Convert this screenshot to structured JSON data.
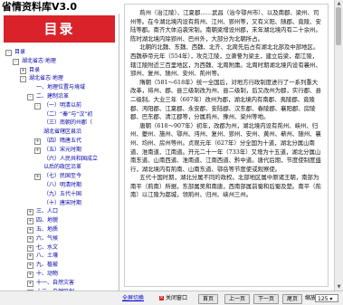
{
  "app": {
    "title": "省情资料库V3.0"
  },
  "sidebar": {
    "header": "目录",
    "tree": [
      {
        "label": "目录",
        "level": 0,
        "toggle": "-"
      },
      {
        "label": "湖北省志·地理",
        "level": 1,
        "toggle": "-"
      },
      {
        "label": "目录",
        "level": 2,
        "toggle": "+"
      },
      {
        "label": "湖北省志·地理",
        "level": 2,
        "toggle": "-"
      },
      {
        "label": "一、地理位置与境域",
        "level": 3,
        "toggle": ""
      },
      {
        "label": "二、建制沿革",
        "level": 3,
        "toggle": "-"
      },
      {
        "label": "（一）明清以前",
        "level": 4,
        "toggle": "-"
      },
      {
        "label": "（二）“秦”与“汉”初",
        "level": 4,
        "toggle": ""
      },
      {
        "label": "（三）南朝的州郡（",
        "level": 4,
        "toggle": ""
      },
      {
        "label": "湖北省辖区县沿",
        "level": 4,
        "toggle": ""
      },
      {
        "label": "（四）隋唐五代",
        "level": 4,
        "toggle": "+"
      },
      {
        "label": "（五）宋元时期",
        "level": 4,
        "toggle": "+"
      },
      {
        "label": "（六）人民共和国成立",
        "level": 4,
        "toggle": ""
      },
      {
        "label": "以后的政区沿革",
        "level": 4,
        "toggle": ""
      },
      {
        "label": "（七）民国至今",
        "level": 4,
        "toggle": "+"
      },
      {
        "label": "（八）明清时期",
        "level": 4,
        "toggle": ""
      },
      {
        "label": "（九）五代十国",
        "level": 4,
        "toggle": ""
      },
      {
        "label": "（十）唐宋时期",
        "level": 4,
        "toggle": ""
      },
      {
        "label": "三、人口",
        "level": 3,
        "toggle": "+"
      },
      {
        "label": "四、地貌",
        "level": 3,
        "toggle": "+"
      },
      {
        "label": "五、地质",
        "level": 3,
        "toggle": "+"
      },
      {
        "label": "六、气候",
        "level": 3,
        "toggle": "+"
      },
      {
        "label": "七、水文",
        "level": 3,
        "toggle": "+"
      },
      {
        "label": "八、土壤",
        "level": 3,
        "toggle": "+"
      },
      {
        "label": "九、植被",
        "level": 3,
        "toggle": "+"
      },
      {
        "label": "十、动物",
        "level": 3,
        "toggle": "+"
      },
      {
        "label": "十一、自然灾害",
        "level": 3,
        "toggle": "+"
      },
      {
        "label": "十二、自然区划",
        "level": 3,
        "toggle": "+"
      }
    ]
  },
  "document": {
    "paragraphs": [
      "荊州（治江陵）、江夏郡……武昌（治今鄂州市）、以及南郡、梁州、司州等。在今湖北境内设有荊州、江州、郢州等，又有义阳、随郡、竟陵、安陆等郡。南齐大体沿袭宋制。南朝梁增设州郡，末年湖北境内有二十余州。陈时湖北境内除郢州、巴州外，大部分为北朝所占。",
      "北朝的北魏、东魏、西魏、北齐、北周先后占有湖北北部及中部地区。西魏恭帝元年（554年），攻克江陵，立萧詧为梁主，建立后梁，都江陵，辖江陵附近三百里地区，为西魏、北周附庸。北周时期湖北境内设有襄州、郢州、复州、随州、安州、荊州等。",
      "隋朝（581～618年）统一全国后，对地方行政制度进行了一系列重大改革，将州、郡、县三级制改为州、县二级制，后又改州为郡，实行郡、县二级制。大业三年（607年）改州为郡，湖北境内有南郡、夷陵郡、竟陵郡、沔阳郡、江夏郡、永安郡、安陆郡、汉东郡、春陵郡、襄阳郡、房陵郡、巴东郡、清江郡等，分属荊州、豫州、梁州等地。",
      "唐朝（618～907年）初年，改郡为州，湖北境内设有荊州、峡州、归州、夔州、施州、鄂州、沔州、复州、郢州、安州、黄州、蕲州、随州、襄州、均州、房州等州。贞观元年（627年）分全国为十道，湖北分属山南道、淮南道、江南道。开元二十一年（733年）又增为十五道，湖北分属山南东道、山南西道、淮南道、江南西道、黔中道。唐代后期，节度使制度盛行，湖北境内有荊南、山南东道、鄂岳等节度使或观察使。",
      "五代十国时期，湖北分属不同的政权。北部地区属中原诸王朝，南部为南平（荊南）所据，东部属吴和南唐，西南部属前蜀和后蜀及楚。南平（荊南）以江陵为都城，领荊州、归州、峡州三州。"
    ]
  },
  "bottombar": {
    "fullscreen": "全屏切换",
    "close": "关闭窗口",
    "home": "首页",
    "prev": "上一页",
    "next": "下一页",
    "last": "尾页",
    "zoom_label": "缩放",
    "zoom_value": "125"
  }
}
